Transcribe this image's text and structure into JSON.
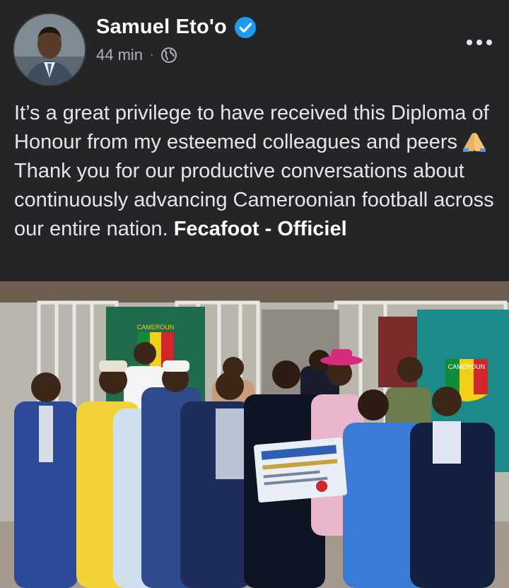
{
  "post": {
    "author": "Samuel Eto'o",
    "time": "44 min",
    "separator": "·",
    "visibility_icon": "globe-icon",
    "verified_icon": "verified-badge-icon",
    "more_icon": "more-options-icon",
    "text_before_emoji": "It’s a great privilege to have received this Diploma of Honour from my esteemed colleagues and peers",
    "emoji_icon": "folded-hands-emoji",
    "text_after_emoji": "Thank you for our productive conversations about continuously advancing Cameroonian football across our entire nation.",
    "mention": "Fecafoot - Officiel"
  },
  "photo": {
    "banner_text": "CAMEROUN",
    "banner_text_right": "CAMEROUN"
  },
  "colors": {
    "background": "#242526",
    "text": "#e4e6eb",
    "secondary_text": "#b0b3b8",
    "verified_blue": "#1d9bf0"
  }
}
